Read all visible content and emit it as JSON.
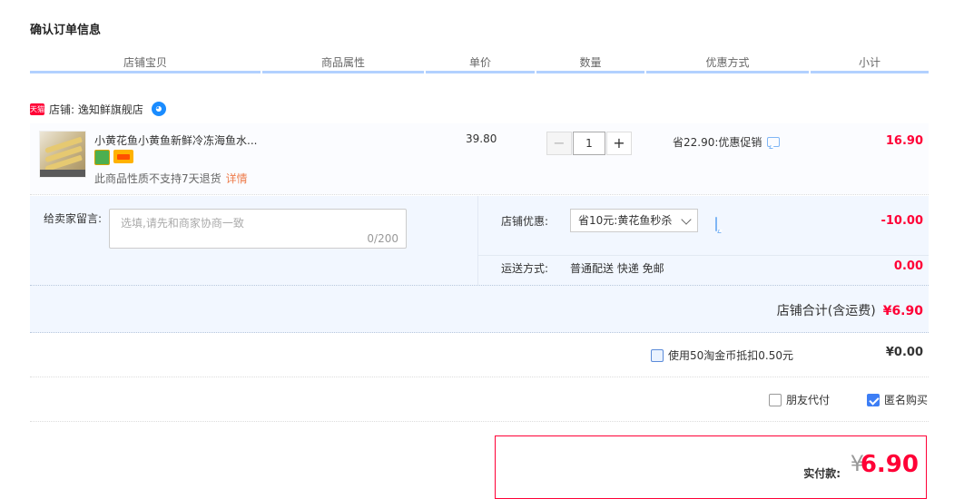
{
  "page": {
    "title": "确认订单信息"
  },
  "table_headers": [
    "店铺宝贝",
    "商品属性",
    "单价",
    "数量",
    "优惠方式",
    "小计"
  ],
  "shop": {
    "badge": "天猫",
    "label": "店铺: 逸知鲜旗舰店",
    "ww_icon": "wangwang-icon"
  },
  "item": {
    "name": "小黄花鱼小黄鱼新鲜冷冻海鱼水...",
    "note": "此商品性质不支持7天退货",
    "detail_link": "详情",
    "unit_price": "39.80",
    "quantity": "1",
    "promo": "省22.90:优惠促销",
    "subtotal": "16.90"
  },
  "message": {
    "label": "给卖家留言:",
    "placeholder": "选填,请先和商家协商一致",
    "count": "0/200"
  },
  "coupon": {
    "label": "店铺优惠:",
    "selected": "省10元:黄花鱼秒杀",
    "amount": "-10.00"
  },
  "shipping": {
    "label": "运送方式:",
    "value": "普通配送 快递 免邮",
    "amount": "0.00"
  },
  "shop_total": {
    "label": "店铺合计(含运费)",
    "amount": "¥6.90"
  },
  "coins": {
    "label": "使用50淘金币抵扣0.50元",
    "amount": "¥0.00",
    "checked": false
  },
  "options": {
    "friend_pay": "朋友代付",
    "anonymous": "匿名购买",
    "anonymous_checked": true
  },
  "payment": {
    "label": "实付款:",
    "yen": "¥",
    "amount": "6.90"
  },
  "colors": {
    "accent_red": "#ff0036",
    "header_line": "#b2d1ff",
    "panel_bg": "#f2f7ff"
  }
}
